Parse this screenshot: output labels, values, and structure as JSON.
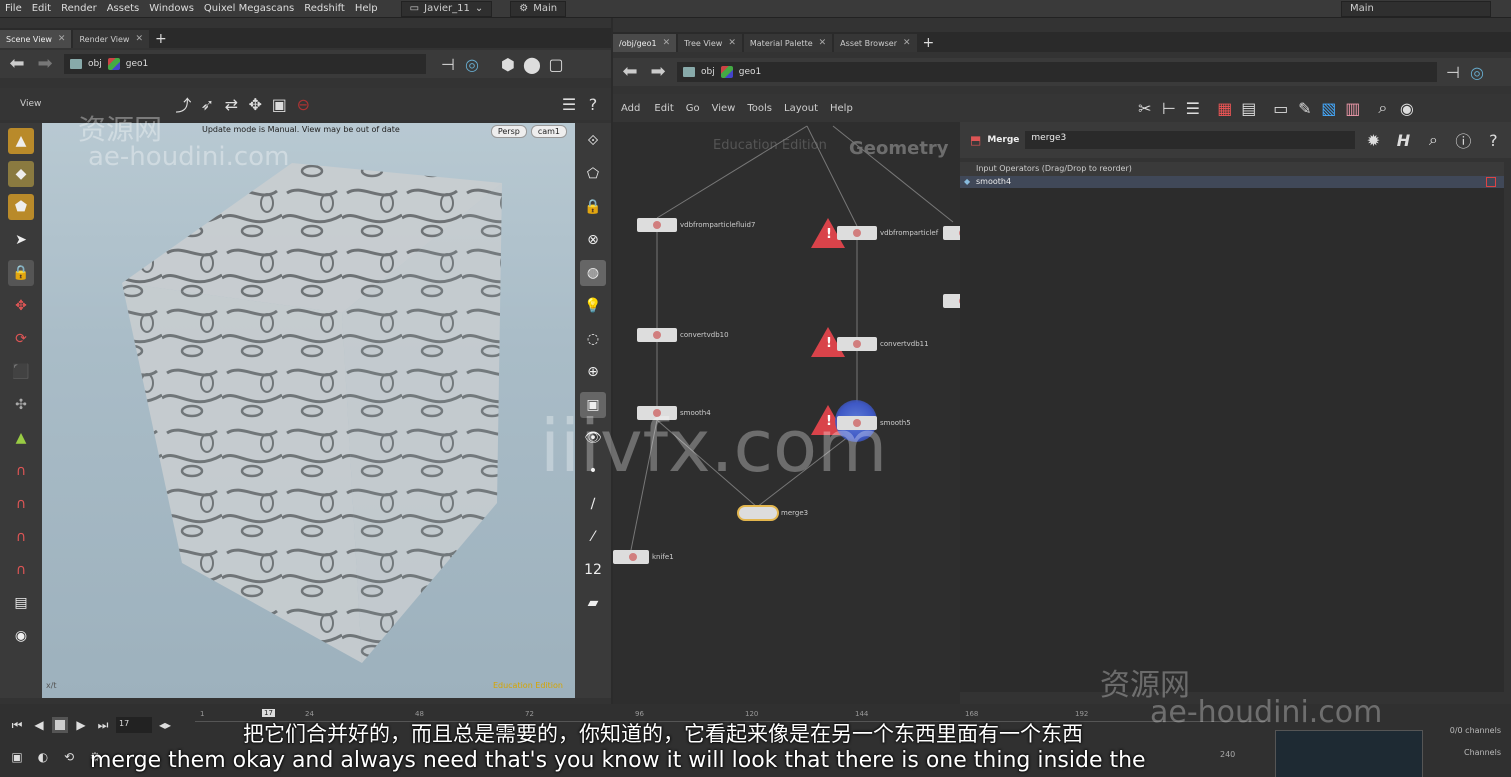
{
  "menu": [
    "File",
    "Edit",
    "Render",
    "Assets",
    "Windows",
    "Quixel Megascans",
    "Redshift",
    "Help"
  ],
  "desktop": "Javier_11",
  "left_desktop": "Main",
  "right_desktop": "Main",
  "left_tabs": [
    "Scene View",
    "Render View"
  ],
  "path_left": {
    "obj": "obj",
    "geo": "geo1"
  },
  "view_label": "View",
  "viewport": {
    "status": "Update mode is Manual. View may be out of date",
    "persp": "Persp",
    "cam": "cam1",
    "corner": "x/t",
    "edition": "Education Edition"
  },
  "right_tabs": [
    "/obj/geo1",
    "Tree View",
    "Material Palette",
    "Asset Browser"
  ],
  "path_right": {
    "obj": "obj",
    "geo": "geo1"
  },
  "network_menu": [
    "Add",
    "Edit",
    "Go",
    "View",
    "Tools",
    "Layout",
    "Help"
  ],
  "network": {
    "title": "Geometry",
    "edition": "Education Edition",
    "nodes": [
      "vdbfromparticlefluid7",
      "vdbfromparticlef",
      "convertvdb10",
      "convertvdb11",
      "smooth4",
      "smooth5",
      "merge3",
      "knife1"
    ]
  },
  "params": {
    "type": "Merge",
    "name": "merge3",
    "list_header": "Input Operators (Drag/Drop to reorder)",
    "items": [
      "smooth4"
    ]
  },
  "timeline": {
    "frame": "17",
    "current": "17",
    "ticks": [
      "1",
      "24",
      "48",
      "72",
      "96",
      "120",
      "144",
      "168",
      "192"
    ],
    "channels": "0/0 channels",
    "channels2": "Channels",
    "end": "240"
  },
  "subtitles": {
    "cn": "把它们合并好的，而且总是需要的，你知道的，它看起来像是在另一个东西里面有一个东西",
    "en": "merge them okay and always need that's you know it will look that there is one thing inside the"
  },
  "watermarks": {
    "site_cn": "资源网",
    "site": "ae-houdini.com",
    "center": "iiivfx.com"
  },
  "colors": {
    "accent": "#e3b64e",
    "warn": "#d9434a",
    "edu": "#d6a500"
  }
}
